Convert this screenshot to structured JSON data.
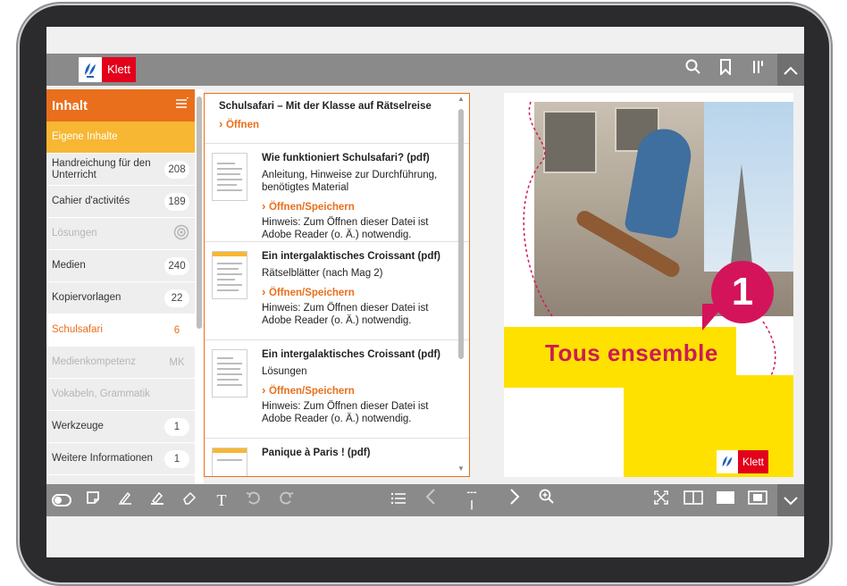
{
  "app": {
    "logo_text": "Klett"
  },
  "toolbar_top": {
    "icons": [
      "search-icon",
      "bookmark-icon",
      "column-icon",
      "collapse-up-icon"
    ]
  },
  "sidebar": {
    "title": "Inhalt",
    "items": [
      {
        "label": "Eigene Inhalte",
        "count": "",
        "state": "own"
      },
      {
        "label": "Handreichung für den Unterricht",
        "count": "208",
        "state": "normal"
      },
      {
        "label": "Cahier d'activités",
        "count": "189",
        "state": "normal"
      },
      {
        "label": "Lösungen",
        "count": "",
        "state": "disabled"
      },
      {
        "label": "Medien",
        "count": "240",
        "state": "normal"
      },
      {
        "label": "Kopiervorlagen",
        "count": "22",
        "state": "normal"
      },
      {
        "label": "Schulsafari",
        "count": "6",
        "state": "active"
      },
      {
        "label": "Medienkompetenz",
        "count": "MK",
        "state": "disabled"
      },
      {
        "label": "Vokabeln, Grammatik",
        "count": "",
        "state": "disabled"
      },
      {
        "label": "Werkzeuge",
        "count": "1",
        "state": "normal"
      },
      {
        "label": "Weitere Informationen",
        "count": "1",
        "state": "normal"
      }
    ]
  },
  "content": {
    "header_title": "Schulsafari – Mit der Klasse auf Rätselreise",
    "header_link": "Öffnen",
    "entries": [
      {
        "title": "Wie funktioniert Schulsafari? (pdf)",
        "desc": "Anleitung, Hinweise zur Durchführung, benötigtes Material",
        "link": "Öffnen/Speichern",
        "note": "Hinweis: Zum Öffnen dieser Datei ist Adobe Reader (o. Ä.) notwendig."
      },
      {
        "title": "Ein intergalaktisches Croissant (pdf)",
        "desc": "Rätselblätter (nach Mag 2)",
        "link": "Öffnen/Speichern",
        "note": "Hinweis: Zum Öffnen dieser Datei ist Adobe Reader (o. Ä.) notwendig."
      },
      {
        "title": "Ein intergalaktisches Croissant (pdf)",
        "desc": "Lösungen",
        "link": "Öffnen/Speichern",
        "note": "Hinweis: Zum Öffnen dieser Datei ist Adobe Reader (o. Ä.) notwendig."
      },
      {
        "title": "Panique à Paris ! (pdf)",
        "desc": "",
        "link": "",
        "note": ""
      }
    ]
  },
  "cover": {
    "title": "Tous ensemble",
    "number": "1",
    "logo_text": "Klett"
  },
  "toolbar_bottom": {
    "page_indicator_top": "---",
    "page_indicator_bottom": "|"
  },
  "colors": {
    "accent_orange": "#e96f1c",
    "own_yellow": "#f7b733",
    "klett_red": "#e3001b",
    "cover_yellow": "#ffe100",
    "cover_magenta": "#d4145a",
    "bar_gray": "#8a8a8a"
  }
}
